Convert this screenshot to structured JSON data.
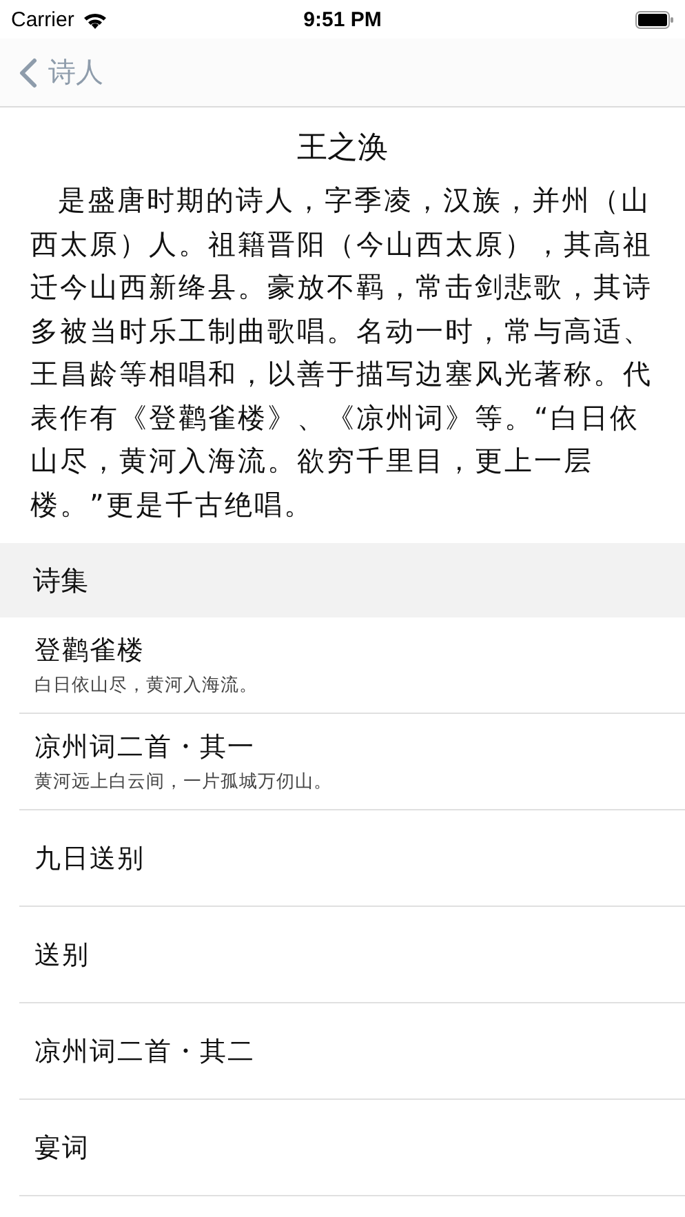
{
  "status_bar": {
    "carrier": "Carrier",
    "time": "9:51 PM"
  },
  "nav": {
    "back_label": "诗人"
  },
  "poet": {
    "name": "王之涣",
    "bio": "是盛唐时期的诗人，字季凌，汉族，并州（山西太原）人。祖籍晋阳（今山西太原），其高祖迁今山西新绛县。豪放不羁，常击剑悲歌，其诗多被当时乐工制曲歌唱。名动一时，常与高适、王昌龄等相唱和，以善于描写边塞风光著称。代表作有《登鹳雀楼》、《凉州词》等。“白日依山尽，黄河入海流。欲穷千里目，更上一层楼。”更是千古绝唱。"
  },
  "section": {
    "title": "诗集"
  },
  "poems": [
    {
      "title": "登鹳雀楼",
      "excerpt": "白日依山尽，黄河入海流。"
    },
    {
      "title": "凉州词二首・其一",
      "excerpt": "黄河远上白云间，一片孤城万仞山。"
    },
    {
      "title": "九日送别"
    },
    {
      "title": "送别"
    },
    {
      "title": "凉州词二首・其二"
    },
    {
      "title": "宴词"
    }
  ]
}
